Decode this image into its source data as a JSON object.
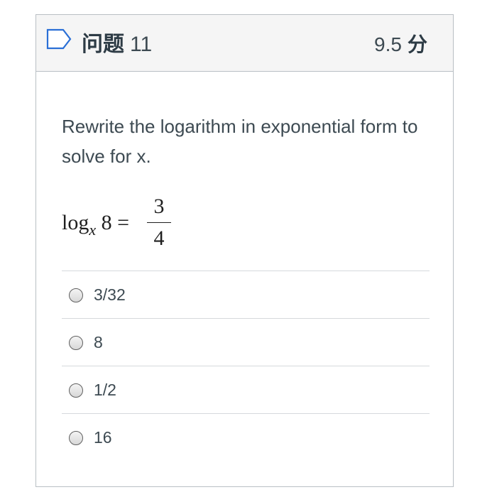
{
  "question": {
    "label": "问题",
    "number": "11",
    "points_value": "9.5",
    "points_unit": "分",
    "text": "Rewrite the logarithm in exponential form to solve for x.",
    "equation": {
      "func": "log",
      "base": "x",
      "argument": "8",
      "equals": "=",
      "numerator": "3",
      "denominator": "4"
    }
  },
  "answers": [
    {
      "label": "3/32"
    },
    {
      "label": "8"
    },
    {
      "label": "1/2"
    },
    {
      "label": "16"
    }
  ],
  "icons": {
    "flag": "flag-icon",
    "radio": "radio-button-icon"
  }
}
